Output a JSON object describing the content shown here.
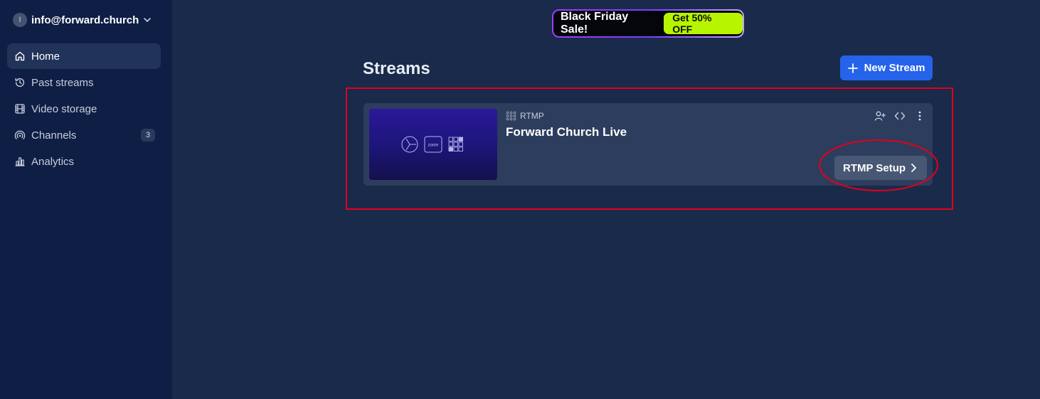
{
  "account": {
    "initial": "I",
    "email": "info@forward.church"
  },
  "sidebar": {
    "items": [
      {
        "label": "Home",
        "icon": "home-icon"
      },
      {
        "label": "Past streams",
        "icon": "history-icon"
      },
      {
        "label": "Video storage",
        "icon": "film-icon"
      },
      {
        "label": "Channels",
        "icon": "broadcast-icon",
        "badge": "3"
      },
      {
        "label": "Analytics",
        "icon": "bar-chart-icon"
      }
    ]
  },
  "promo": {
    "text": "Black Friday Sale!",
    "cta": "Get 50% OFF"
  },
  "main": {
    "title": "Streams",
    "new_stream_label": "New Stream"
  },
  "stream": {
    "type": "RTMP",
    "title": "Forward Church Live",
    "thumbnail_zoom_text": "zoom",
    "setup_label": "RTMP Setup"
  },
  "colors": {
    "sidebar_bg": "#0f1e45",
    "main_bg": "#192a4b",
    "card_bg": "#2d3d5d",
    "primary_button": "#2563eb",
    "promo_cta": "#b7f400",
    "annotation_red": "#e3001b"
  }
}
